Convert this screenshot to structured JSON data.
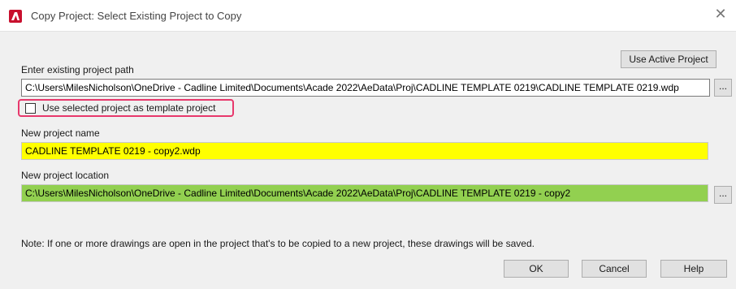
{
  "window": {
    "title": "Copy Project: Select Existing Project to Copy",
    "close_glyph": "✕",
    "app_icon": "autocad-electrical-icon"
  },
  "form": {
    "use_active_project_label": "Use Active Project",
    "existing_path_label": "Enter existing project path",
    "existing_path_value": "C:\\Users\\MilesNicholson\\OneDrive - Cadline Limited\\Documents\\Acade 2022\\AeData\\Proj\\CADLINE TEMPLATE 0219\\CADLINE TEMPLATE 0219.wdp",
    "browse_label": "...",
    "use_template_checkbox_label": "Use selected project as template project",
    "use_template_checked": false,
    "new_name_label": "New project name",
    "new_name_value": "CADLINE TEMPLATE 0219 - copy2.wdp",
    "new_location_label": "New project location",
    "new_location_value": "C:\\Users\\MilesNicholson\\OneDrive - Cadline Limited\\Documents\\Acade 2022\\AeData\\Proj\\CADLINE TEMPLATE 0219 - copy2",
    "note": "Note: If one or more drawings are open in the project that's to be copied to a new project, these drawings will be saved."
  },
  "buttons": {
    "ok": "OK",
    "cancel": "Cancel",
    "help": "Help"
  },
  "colors": {
    "name_field_bg": "#ffff00",
    "location_field_bg": "#92d050",
    "highlight_border": "#e8386c",
    "app_icon_bg": "#c8102e"
  }
}
